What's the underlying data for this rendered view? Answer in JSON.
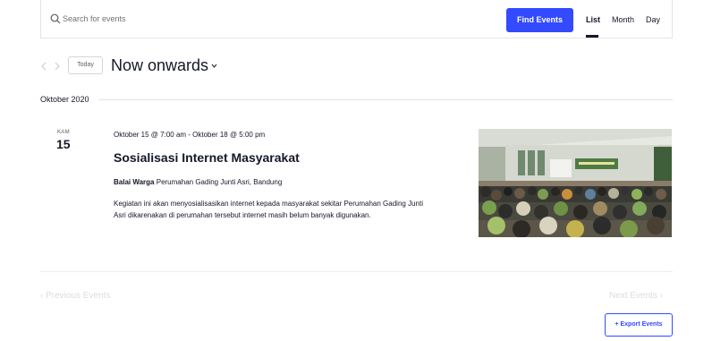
{
  "search": {
    "placeholder": "Search for events"
  },
  "toolbar": {
    "find_label": "Find Events",
    "views": {
      "list": "List",
      "month": "Month",
      "day": "Day"
    },
    "active_view": "List"
  },
  "navigation": {
    "today_label": "Today",
    "range_title": "Now onwards"
  },
  "month_separator": "Oktober 2020",
  "event": {
    "day_name": "KAM",
    "day_number": "15",
    "datetime": "Oktober 15 @ 7:00 am - Oktober 18 @ 5:00 pm",
    "title": "Sosialisasi Internet Masyarakat",
    "venue_name": "Balai Warga",
    "venue_address": "Perumahan Gading Junti Asri, Bandung",
    "description_line1": "Kegiatan ini akan menyosialisasikan internet kepada masyarakat sekitar Perumahan Gading Junti",
    "description_line2": "Asri dikarenakan di perumahan tersebut internet masih belum banyak digunakan."
  },
  "pagination": {
    "prev_label": "Previous Events",
    "next_label": "Next Events"
  },
  "export": {
    "label": "Export Events"
  },
  "colors": {
    "accent": "#334aff",
    "text": "#141827",
    "muted": "#727272",
    "disabled": "#dcdcdc"
  }
}
